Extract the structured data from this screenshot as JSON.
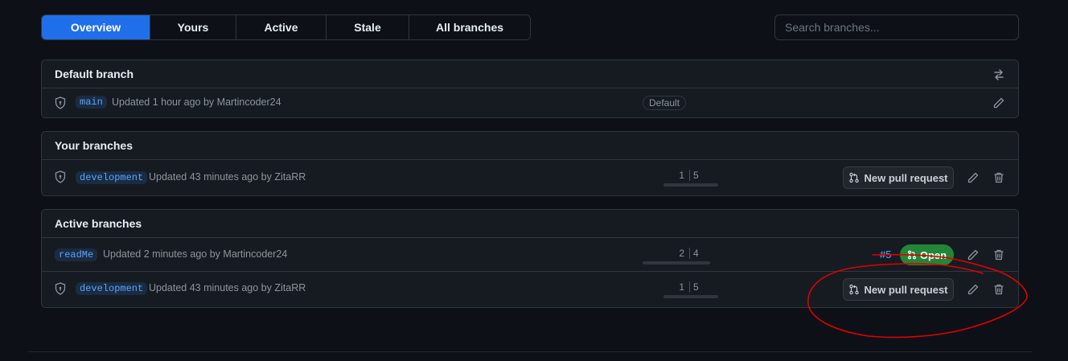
{
  "tabs": [
    {
      "label": "Overview",
      "selected": true
    },
    {
      "label": "Yours",
      "selected": false
    },
    {
      "label": "Active",
      "selected": false
    },
    {
      "label": "Stale",
      "selected": false
    },
    {
      "label": "All branches",
      "selected": false
    }
  ],
  "search": {
    "placeholder": "Search branches..."
  },
  "default_section": {
    "title": "Default branch",
    "row": {
      "branch": "main",
      "updated": "Updated 1 hour ago by Martincoder24",
      "badge": "Default"
    }
  },
  "your_section": {
    "title": "Your branches",
    "row": {
      "branch": "development",
      "updated": "Updated 43 minutes ago by ZitaRR",
      "behind": "1",
      "ahead": "5",
      "pr_button": "New pull request"
    }
  },
  "active_section": {
    "title": "Active branches",
    "rows": [
      {
        "branch": "readMe",
        "updated": "Updated 2 minutes ago by Martincoder24",
        "behind": "2",
        "ahead": "4",
        "pr_number": "#5",
        "pr_state": "Open"
      },
      {
        "branch": "development",
        "updated": "Updated 43 minutes ago by ZitaRR",
        "behind": "1",
        "ahead": "5",
        "pr_button": "New pull request"
      }
    ]
  },
  "colors": {
    "accent": "#1f6feb",
    "open": "#238636",
    "annotation": "#e00000"
  }
}
